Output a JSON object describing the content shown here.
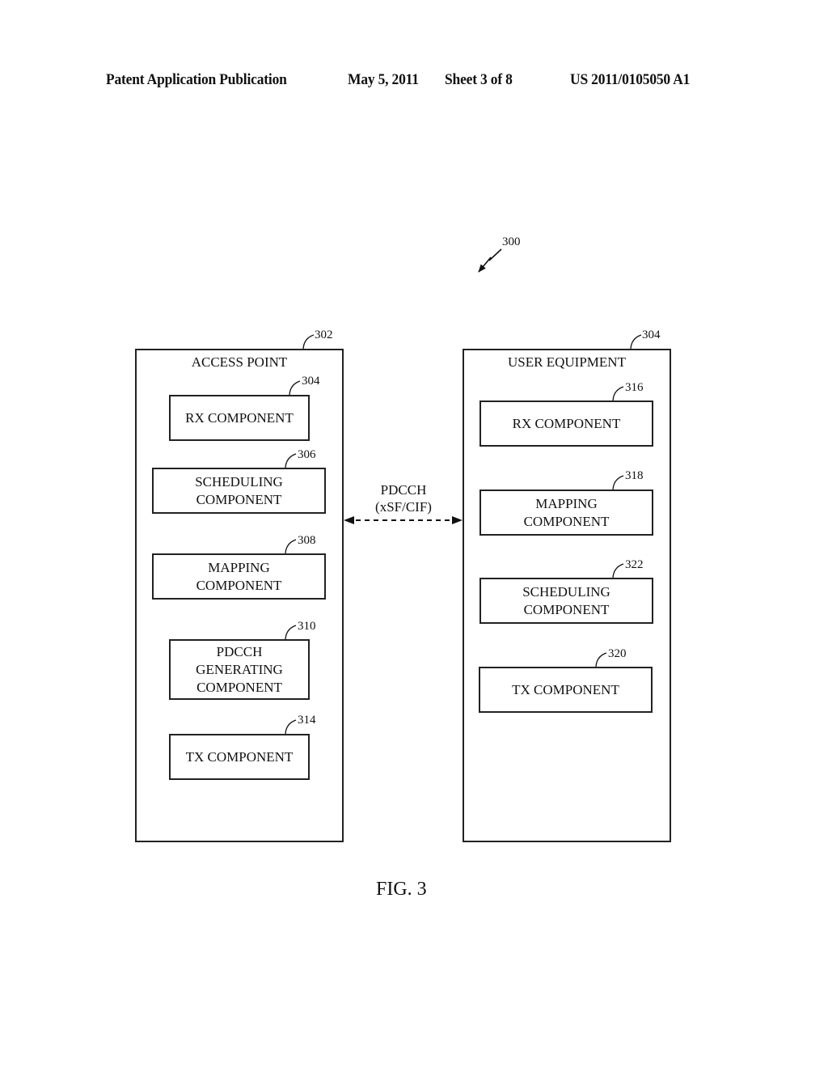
{
  "header": {
    "publication": "Patent Application Publication",
    "date": "May 5, 2011",
    "sheet": "Sheet 3 of 8",
    "number": "US 2011/0105050 A1"
  },
  "figure": {
    "ref": "300",
    "caption": "FIG. 3"
  },
  "link": {
    "label_line1": "PDCCH",
    "label_line2": "(xSF/CIF)",
    "style": "dashed bidirectional arrow"
  },
  "access_point": {
    "title": "ACCESS POINT",
    "ref": "302",
    "components": [
      {
        "label": "RX COMPONENT",
        "ref": "304"
      },
      {
        "label": "SCHEDULING\nCOMPONENT",
        "ref": "306"
      },
      {
        "label": "MAPPING\nCOMPONENT",
        "ref": "308"
      },
      {
        "label": "PDCCH\nGENERATING\nCOMPONENT",
        "ref": "310"
      },
      {
        "label": "TX COMPONENT",
        "ref": "314"
      }
    ]
  },
  "user_equipment": {
    "title": "USER EQUIPMENT",
    "ref": "304",
    "components": [
      {
        "label": "RX COMPONENT",
        "ref": "316"
      },
      {
        "label": "MAPPING\nCOMPONENT",
        "ref": "318"
      },
      {
        "label": "SCHEDULING\nCOMPONENT",
        "ref": "322"
      },
      {
        "label": "TX COMPONENT",
        "ref": "320"
      }
    ]
  }
}
